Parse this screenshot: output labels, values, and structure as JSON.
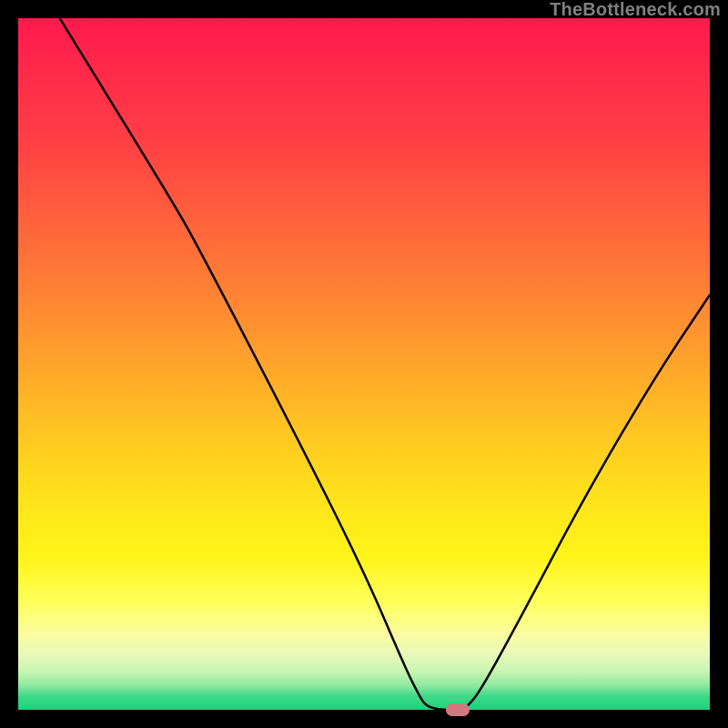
{
  "watermark": "TheBottleneck.com",
  "chart_data": {
    "type": "line",
    "title": "",
    "xlabel": "",
    "ylabel": "",
    "xlim": [
      0,
      100
    ],
    "ylim": [
      0,
      100
    ],
    "background": "vertical_gradient_red_to_green",
    "series": [
      {
        "name": "bottleneck-curve",
        "points": [
          {
            "x": 6,
            "y": 100
          },
          {
            "x": 22,
            "y": 74
          },
          {
            "x": 26,
            "y": 67
          },
          {
            "x": 40,
            "y": 40
          },
          {
            "x": 50,
            "y": 20
          },
          {
            "x": 56,
            "y": 6
          },
          {
            "x": 58,
            "y": 2
          },
          {
            "x": 59,
            "y": 0.5
          },
          {
            "x": 61,
            "y": 0
          },
          {
            "x": 64,
            "y": 0
          },
          {
            "x": 65,
            "y": 0.5
          },
          {
            "x": 67,
            "y": 3
          },
          {
            "x": 73,
            "y": 14
          },
          {
            "x": 82,
            "y": 31
          },
          {
            "x": 92,
            "y": 48
          },
          {
            "x": 100,
            "y": 60
          }
        ]
      }
    ],
    "marker": {
      "x": 63.5,
      "y": 0,
      "color": "#d17a7e"
    }
  }
}
